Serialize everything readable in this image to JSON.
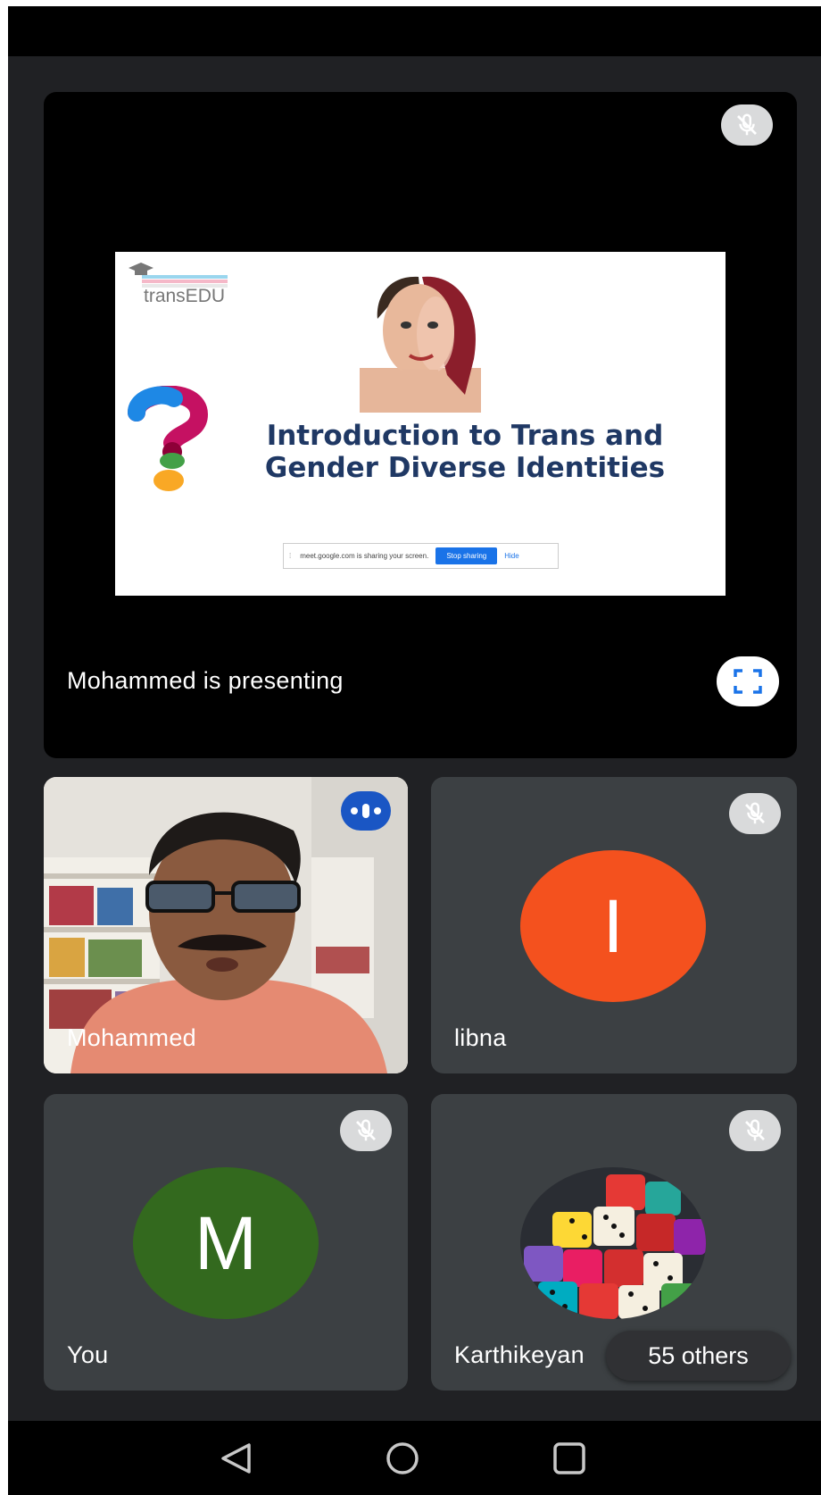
{
  "presentation": {
    "presenter_label": "Mohammed is presenting",
    "slide": {
      "logo_text": "transEDU",
      "title_line1": "Introduction to Trans and",
      "title_line2": "Gender Diverse Identities",
      "share_bar_text": "meet.google.com is sharing your screen.",
      "stop_sharing_label": "Stop sharing",
      "hide_label": "Hide"
    }
  },
  "participants": [
    {
      "name": "Mohammed",
      "state": "speaking",
      "avatar": "camera-video"
    },
    {
      "name": "libna",
      "state": "muted",
      "avatar_letter": "I",
      "avatar_color": "#f4511e"
    },
    {
      "name": "You",
      "state": "muted",
      "avatar_letter": "M",
      "avatar_color": "#33691e"
    },
    {
      "name": "Karthikeyan",
      "state": "muted",
      "avatar": "dice-photo"
    }
  ],
  "others_label": "55 others",
  "colors": {
    "meet_blue": "#1a73e8",
    "slide_title": "#1f3864",
    "tile_bg": "#3c4043"
  }
}
